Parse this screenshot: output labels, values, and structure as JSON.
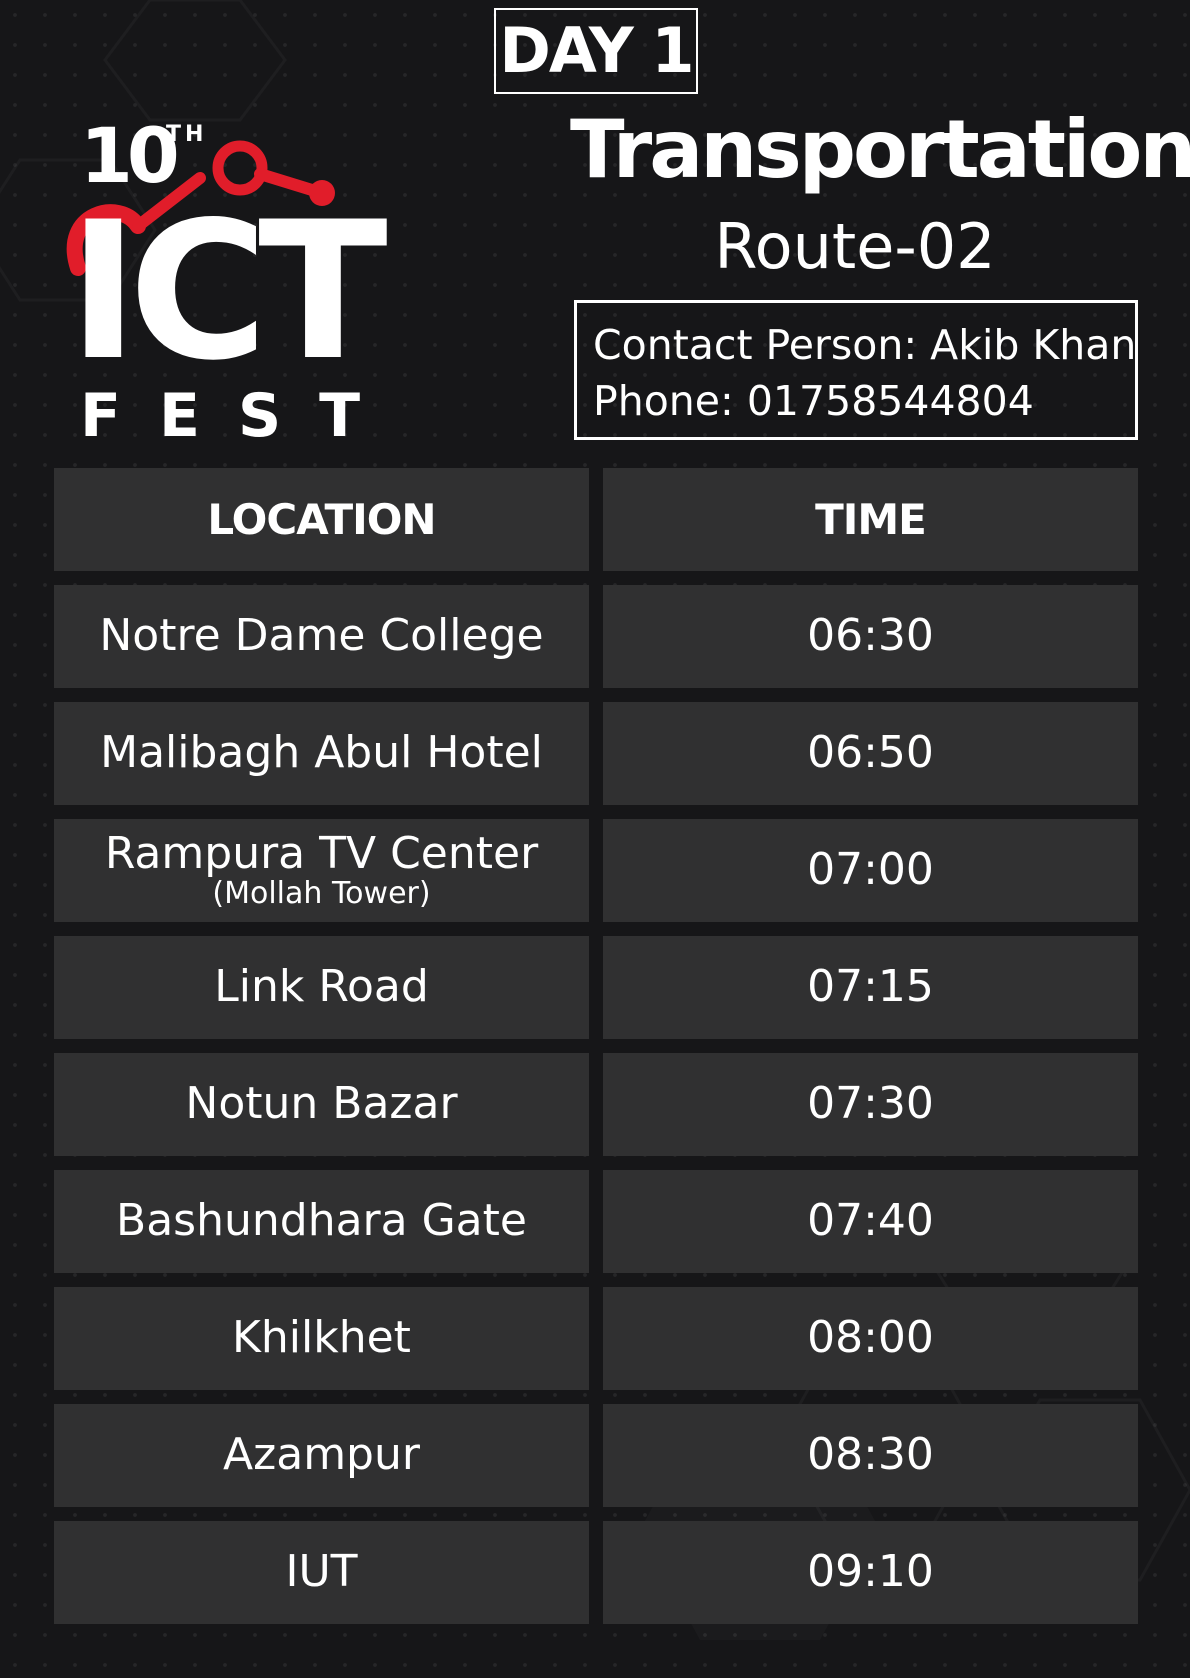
{
  "badge": {
    "day": "DAY 1"
  },
  "logo": {
    "edition": "10",
    "suffix": "TH",
    "name": "ICT",
    "word": "FEST"
  },
  "header": {
    "title": "Transportation",
    "route": "Route-02",
    "contact_line": "Contact Person: Akib Khan",
    "phone_line": "Phone: 01758544804"
  },
  "table": {
    "headers": {
      "location": "LOCATION",
      "time": "TIME"
    },
    "rows": [
      {
        "location": "Notre Dame College",
        "sub": "",
        "time": "06:30"
      },
      {
        "location": "Malibagh Abul Hotel",
        "sub": "",
        "time": "06:50"
      },
      {
        "location": "Rampura TV Center",
        "sub": "(Mollah Tower)",
        "time": "07:00"
      },
      {
        "location": "Link Road",
        "sub": "",
        "time": "07:15"
      },
      {
        "location": "Notun Bazar",
        "sub": "",
        "time": "07:30"
      },
      {
        "location": "Bashundhara Gate",
        "sub": "",
        "time": "07:40"
      },
      {
        "location": "Khilkhet",
        "sub": "",
        "time": "08:00"
      },
      {
        "location": "Azampur",
        "sub": "",
        "time": "08:30"
      },
      {
        "location": "IUT",
        "sub": "",
        "time": "09:10"
      }
    ]
  },
  "colors": {
    "background": "#161618",
    "cell": "#303031",
    "accent": "#e11d2a",
    "text": "#ffffff"
  }
}
